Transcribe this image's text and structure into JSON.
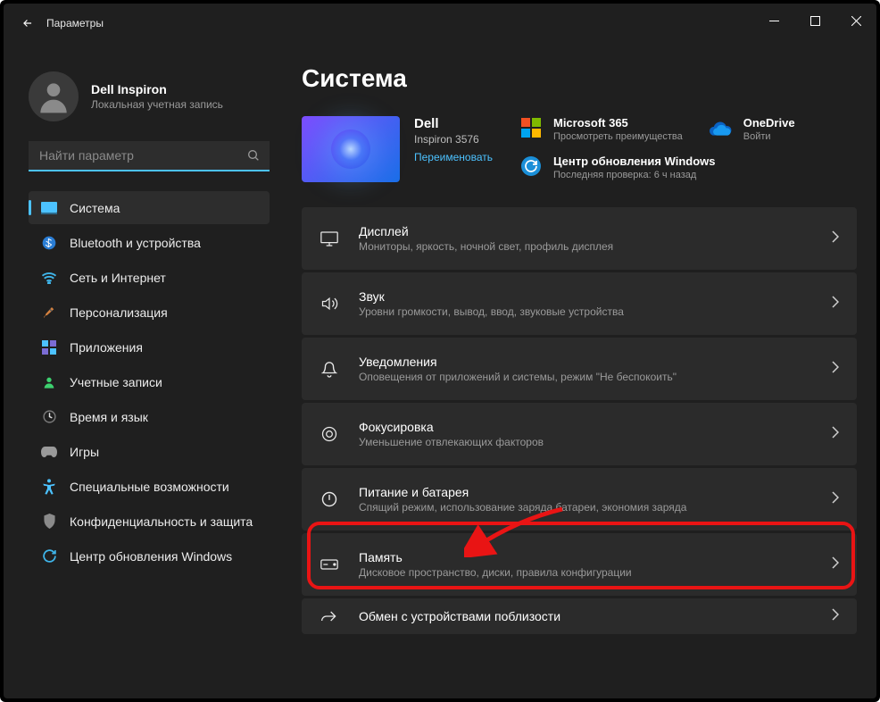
{
  "window": {
    "title": "Параметры"
  },
  "profile": {
    "name": "Dell Inspiron",
    "sub": "Локальная учетная запись"
  },
  "search": {
    "placeholder": "Найти параметр"
  },
  "sidebar": {
    "items": [
      {
        "label": "Система"
      },
      {
        "label": "Bluetooth и устройства"
      },
      {
        "label": "Сеть и Интернет"
      },
      {
        "label": "Персонализация"
      },
      {
        "label": "Приложения"
      },
      {
        "label": "Учетные записи"
      },
      {
        "label": "Время и язык"
      },
      {
        "label": "Игры"
      },
      {
        "label": "Специальные возможности"
      },
      {
        "label": "Конфиденциальность и защита"
      },
      {
        "label": "Центр обновления Windows"
      }
    ]
  },
  "page": {
    "title": "Система"
  },
  "device": {
    "name": "Dell",
    "model": "Inspiron 3576",
    "rename": "Переименовать"
  },
  "cards": {
    "ms365": {
      "title": "Microsoft 365",
      "sub": "Просмотреть преимущества"
    },
    "onedrive": {
      "title": "OneDrive",
      "sub": "Войти"
    },
    "update": {
      "title": "Центр обновления Windows",
      "sub": "Последняя проверка: 6 ч назад"
    }
  },
  "list": [
    {
      "title": "Дисплей",
      "sub": "Мониторы, яркость, ночной свет, профиль дисплея"
    },
    {
      "title": "Звук",
      "sub": "Уровни громкости, вывод, ввод, звуковые устройства"
    },
    {
      "title": "Уведомления",
      "sub": "Оповещения от приложений и системы, режим \"Не беспокоить\""
    },
    {
      "title": "Фокусировка",
      "sub": "Уменьшение отвлекающих факторов"
    },
    {
      "title": "Питание и батарея",
      "sub": "Спящий режим, использование заряда батареи, экономия заряда"
    },
    {
      "title": "Память",
      "sub": "Дисковое пространство, диски, правила конфигурации"
    },
    {
      "title": "Обмен с устройствами поблизости",
      "sub": ""
    }
  ]
}
